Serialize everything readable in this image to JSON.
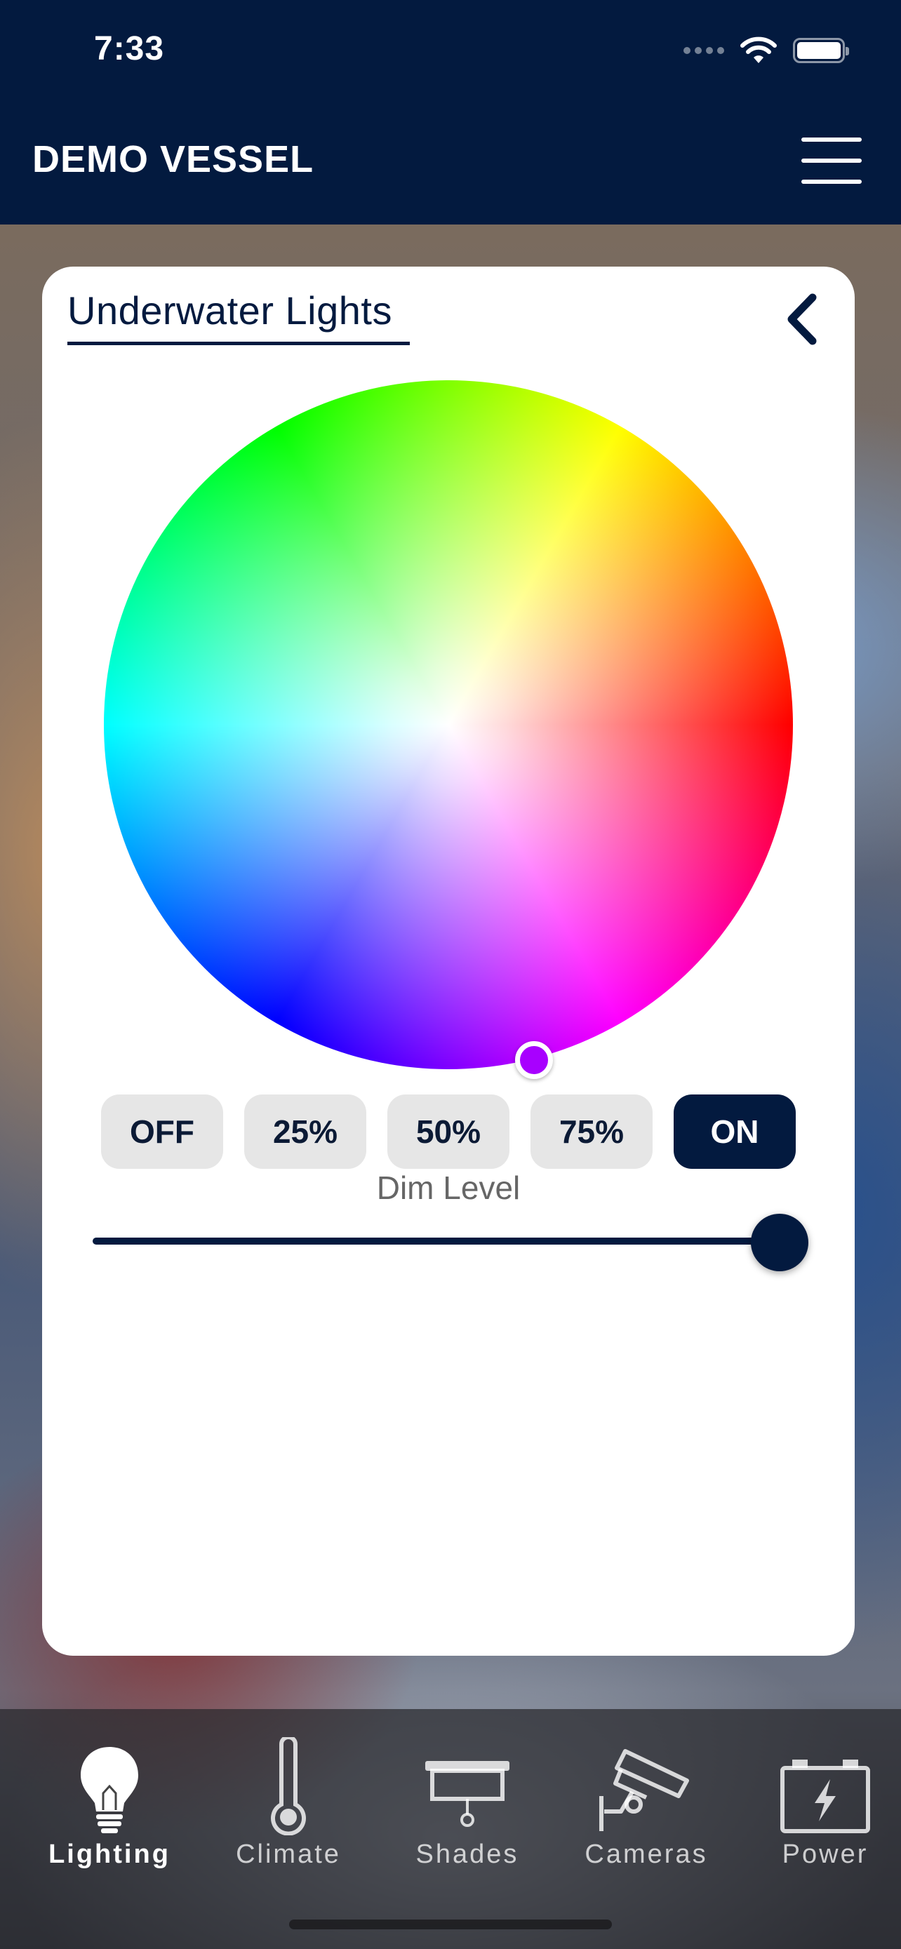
{
  "status_bar": {
    "time": "7:33"
  },
  "header": {
    "title": "DEMO VESSEL"
  },
  "card": {
    "title": "Underwater Lights",
    "selected_color": "#a800ff",
    "presets": [
      {
        "label": "OFF",
        "active": false
      },
      {
        "label": "25%",
        "active": false
      },
      {
        "label": "50%",
        "active": false
      },
      {
        "label": "75%",
        "active": false
      },
      {
        "label": "ON",
        "active": true
      }
    ],
    "dim_label": "Dim Level",
    "dim_level": 1.0
  },
  "tabs": [
    {
      "label": "Lighting",
      "icon": "light-bulb-icon",
      "active": true
    },
    {
      "label": "Climate",
      "icon": "thermometer-icon",
      "active": false
    },
    {
      "label": "Shades",
      "icon": "shade-icon",
      "active": false
    },
    {
      "label": "Cameras",
      "icon": "security-camera-icon",
      "active": false
    },
    {
      "label": "Power",
      "icon": "battery-icon",
      "active": false
    }
  ],
  "colors": {
    "navy": "#031a3f",
    "preset_bg": "#e6e6e6"
  }
}
